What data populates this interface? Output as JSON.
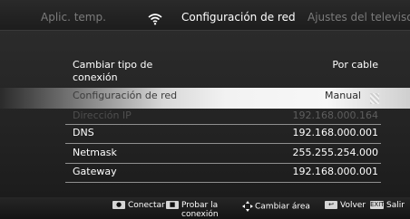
{
  "tabs": {
    "left": "Aplic. temp.",
    "center": "Configuración de red",
    "right": "Ajustes del televisor"
  },
  "settings": {
    "connection_type": {
      "label": "Cambiar tipo de\nconexión",
      "value": "Por cable"
    },
    "network_config": {
      "label": "Configuración de red",
      "value": "Manual"
    },
    "ip": {
      "label": "Dirección IP",
      "value": "192.168.000.164"
    },
    "dns": {
      "label": "DNS",
      "value": "192.168.000.001"
    },
    "netmask": {
      "label": "Netmask",
      "value": "255.255.254.000"
    },
    "gateway": {
      "label": "Gateway",
      "value": "192.168.000.001"
    }
  },
  "footer": {
    "connect": "Conectar",
    "test": "Probar la\nconexión",
    "change_area": "Cambiar área",
    "back": "Volver",
    "exit_key": "EXIT",
    "exit": "Salir"
  },
  "icons": {
    "wifi": "wifi-icon",
    "dpad": "dpad-icon"
  }
}
